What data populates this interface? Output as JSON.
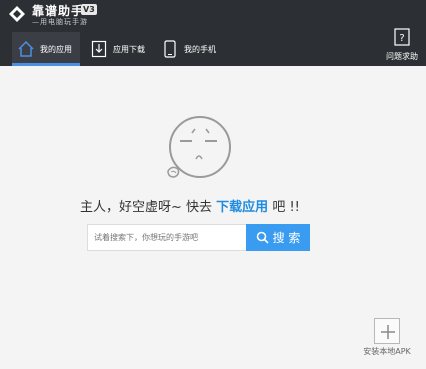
{
  "app": {
    "name": "靠谱助手",
    "version_badge": "V3",
    "subtitle": "—用电脑玩手游"
  },
  "tabs": [
    {
      "label": "我的应用",
      "icon": "home-icon"
    },
    {
      "label": "应用下载",
      "icon": "download-icon"
    },
    {
      "label": "我的手机",
      "icon": "phone-icon"
    }
  ],
  "help": {
    "label": "问题求助",
    "icon": "question-icon"
  },
  "empty_state": {
    "prefix": "主人，好空虚呀~ 快去",
    "link": "下载应用",
    "suffix": "吧 !!"
  },
  "search": {
    "placeholder": "试着搜索下，你想玩的手游吧",
    "button_label": "搜 索"
  },
  "install": {
    "label": "安装本地APK"
  },
  "colors": {
    "header": "#2c2f33",
    "accent": "#3a9cf0",
    "link": "#1f8ce0"
  }
}
